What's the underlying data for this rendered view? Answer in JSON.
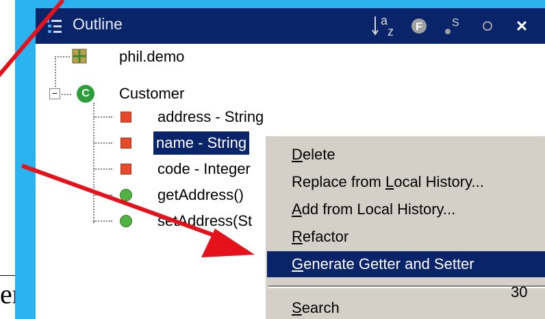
{
  "window": {
    "title": "Outline"
  },
  "toolbar": {
    "sort_icon": "sort-alpha-icon",
    "fields_icon": "hide-fields-icon",
    "static_icon": "hide-static-icon",
    "nonpublic_icon": "hide-nonpublic-icon",
    "close_label": "×",
    "fields_glyph": "F",
    "static_glyph": "S"
  },
  "tree": {
    "package": "phil.demo",
    "class": {
      "name": "Customer",
      "icon_glyph": "C"
    },
    "members": [
      {
        "label": "address - String",
        "kind": "field"
      },
      {
        "label": "name - String",
        "kind": "field",
        "selected": true
      },
      {
        "label": "code - Integer",
        "kind": "field"
      },
      {
        "label": "getAddress()",
        "kind": "method"
      },
      {
        "label": "setAddress(St",
        "kind": "method"
      }
    ]
  },
  "context_menu": {
    "items": [
      {
        "label": "Delete",
        "underline": "D",
        "rest": "elete"
      },
      {
        "label": "Replace from Local History...",
        "pre": "Replace from ",
        "underline": "L",
        "rest": "ocal History..."
      },
      {
        "label": "Add from Local History...",
        "underline": "A",
        "rest": "dd from Local History..."
      },
      {
        "label": "Refactor",
        "underline": "R",
        "rest": "efactor",
        "submenu": true
      },
      {
        "label": "Generate Getter and Setter",
        "underline": "G",
        "rest": "enerate Getter and Setter",
        "highlighted": true
      },
      {
        "label": "Search",
        "underline": "S",
        "rest": "earch",
        "submenu": true
      }
    ]
  },
  "slide": {
    "page_number": "30",
    "edge_text": "er"
  },
  "colors": {
    "titlebar": "#0a246a",
    "border": "#2ab3ee",
    "arrow": "#e5121b",
    "menu_bg": "#d4d0c8"
  }
}
